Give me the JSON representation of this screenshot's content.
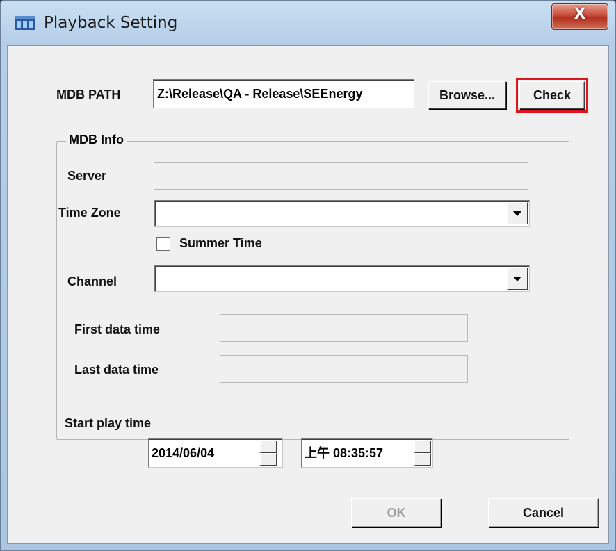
{
  "window": {
    "title": "Playback Setting",
    "close_label": "X"
  },
  "mdb_path": {
    "label": "MDB PATH",
    "value": "Z:\\Release\\QA - Release\\SEEnergy",
    "browse_label": "Browse...",
    "check_label": "Check"
  },
  "mdb_info": {
    "group_label": "MDB Info",
    "server_label": "Server",
    "server_value": "",
    "time_zone_label": "Time Zone",
    "time_zone_value": "",
    "summer_time_label": "Summer Time",
    "summer_time_checked": false,
    "channel_label": "Channel",
    "channel_value": "",
    "first_data_time_label": "First data time",
    "first_data_time_value": "",
    "last_data_time_label": "Last data time",
    "last_data_time_value": ""
  },
  "start_play": {
    "label": "Start play time",
    "date_value": "2014/06/04",
    "time_value": "上午 08:35:57"
  },
  "footer": {
    "ok_label": "OK",
    "cancel_label": "Cancel"
  },
  "colors": {
    "highlight": "#e0141e",
    "close_button": "#c9493a",
    "dialog_bg": "#f0f0f0"
  }
}
